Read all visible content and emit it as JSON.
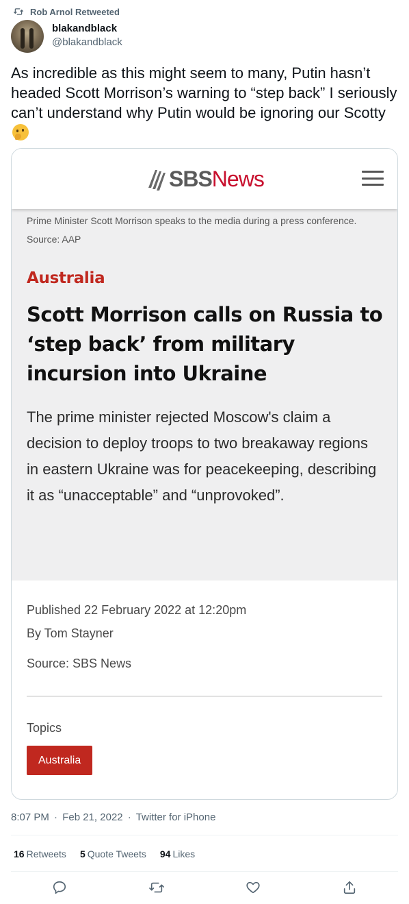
{
  "retweet_context": {
    "text": "Rob Arnol Retweeted",
    "icon": "retweet-icon"
  },
  "author": {
    "display_name": "blakandblack",
    "handle": "@blakandblack"
  },
  "tweet": {
    "text": "As incredible as this might seem to many, Putin hasn’t headed Scott Morrison’s warning to “step back” I seriously can’t understand why Putin would be ignoring our Scotty",
    "emoji": "thinking-face-emoji"
  },
  "article": {
    "logo": {
      "sbs": "SBS",
      "news": "News"
    },
    "caption": "Prime Minister Scott Morrison speaks to the media during a press conference. Source: AAP",
    "section": "Australia",
    "headline": "Scott Morrison calls on Russia to ‘step back’ from military incursion into Ukraine",
    "standfirst": "The prime minister rejected Moscow's claim a decision to deploy troops to two breakaway regions in eastern Ukraine was for peacekeeping, describing it as “unacceptable” and “unprovoked”.",
    "published": "Published 22 February 2022 at 12:20pm",
    "byline": "By Tom Stayner",
    "source": "Source: SBS News",
    "topics_label": "Topics",
    "topic": "Australia"
  },
  "meta": {
    "time": "8:07 PM",
    "date": "Feb 21, 2022",
    "client": "Twitter for iPhone",
    "separator": "·"
  },
  "stats": {
    "retweets_count": "16",
    "retweets_label": "Retweets",
    "quotes_count": "5",
    "quotes_label": "Quote Tweets",
    "likes_count": "94",
    "likes_label": "Likes"
  },
  "actions": [
    "reply-icon",
    "retweet-icon",
    "like-icon",
    "share-icon"
  ],
  "colors": {
    "sbs_red": "#c0281f",
    "twitter_gray": "#536471",
    "article_bg": "#efeff0"
  }
}
